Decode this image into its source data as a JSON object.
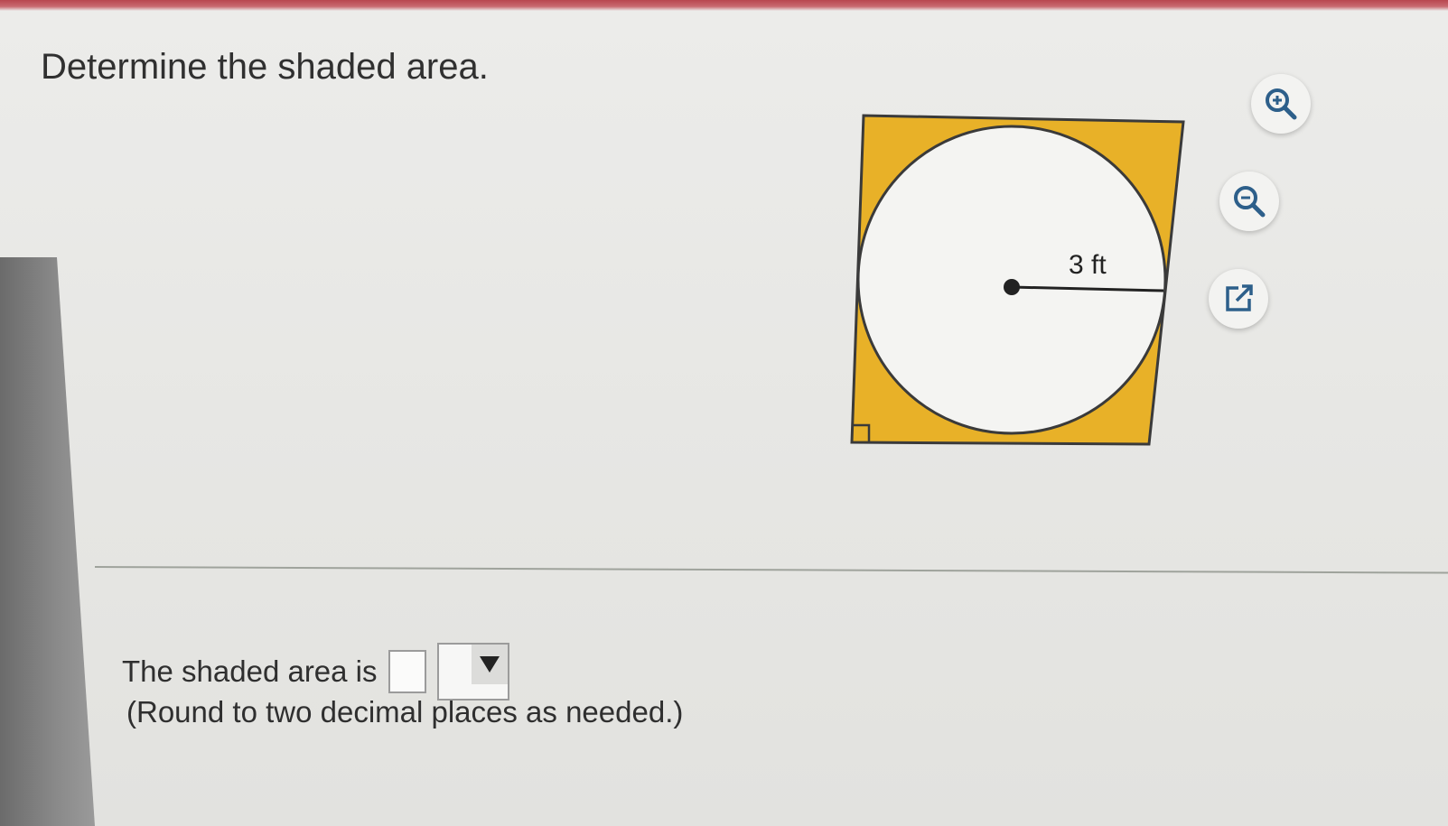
{
  "question": {
    "prompt": "Determine the shaded area."
  },
  "figure": {
    "radius_label": "3 ft",
    "shading_color": "#e8b128",
    "circle_fill": "#f4f4f2",
    "outline_color": "#3a3a3a"
  },
  "tools": {
    "zoom_in_icon": "zoom-in-icon",
    "zoom_out_icon": "zoom-out-icon",
    "popout_icon": "popout-icon",
    "icon_color": "#2d5f8a"
  },
  "answer": {
    "label": "The shaded area is",
    "input_value": "",
    "unit_selected": "",
    "hint": "(Round to two decimal places as needed.)"
  }
}
